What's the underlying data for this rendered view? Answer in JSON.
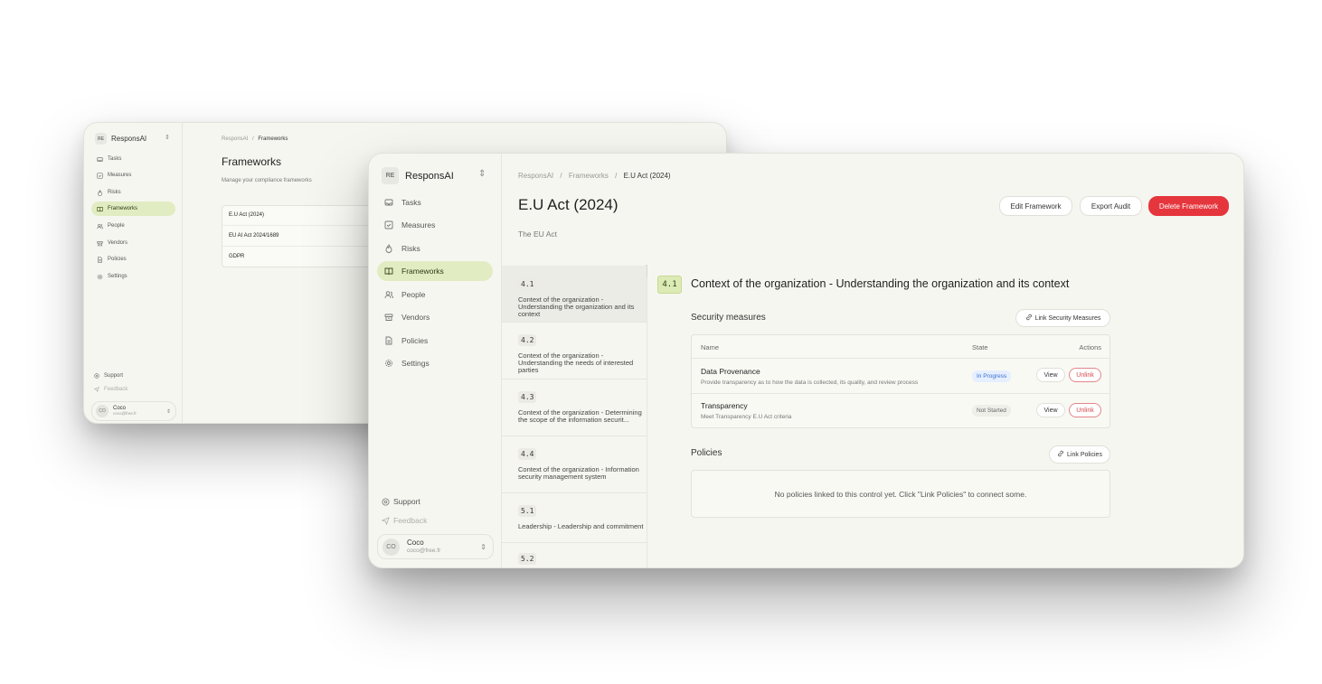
{
  "back_window": {
    "brand": {
      "logo": "RE",
      "name": "ResponsAI"
    },
    "nav": [
      {
        "label": "Tasks",
        "icon": "inbox-icon"
      },
      {
        "label": "Measures",
        "icon": "checkbox-icon"
      },
      {
        "label": "Risks",
        "icon": "flame-icon"
      },
      {
        "label": "Frameworks",
        "icon": "book-icon"
      },
      {
        "label": "People",
        "icon": "people-icon"
      },
      {
        "label": "Vendors",
        "icon": "box-icon"
      },
      {
        "label": "Policies",
        "icon": "file-icon"
      },
      {
        "label": "Settings",
        "icon": "gear-icon"
      }
    ],
    "footer": {
      "support": "Support",
      "feedback": "Feedback"
    },
    "user": {
      "initials": "CO",
      "name": "Coco",
      "email": "coco@free.fr"
    },
    "breadcrumb": {
      "root": "ResponsAI",
      "sep": "/",
      "current": "Frameworks"
    },
    "title": "Frameworks",
    "subtitle": "Manage your compliance frameworks",
    "frameworks": [
      "E.U Act (2024)",
      "EU AI Act 2024/1689",
      "GDPR"
    ]
  },
  "front_window": {
    "brand": {
      "logo": "RE",
      "name": "ResponsAI"
    },
    "nav": [
      {
        "label": "Tasks",
        "icon": "inbox-icon"
      },
      {
        "label": "Measures",
        "icon": "checkbox-icon"
      },
      {
        "label": "Risks",
        "icon": "flame-icon"
      },
      {
        "label": "Frameworks",
        "icon": "book-icon"
      },
      {
        "label": "People",
        "icon": "people-icon"
      },
      {
        "label": "Vendors",
        "icon": "box-icon"
      },
      {
        "label": "Policies",
        "icon": "file-icon"
      },
      {
        "label": "Settings",
        "icon": "gear-icon"
      }
    ],
    "footer": {
      "support": "Support",
      "feedback": "Feedback"
    },
    "user": {
      "initials": "CO",
      "name": "Coco",
      "email": "coco@free.fr"
    },
    "breadcrumb": {
      "root": "ResponsAI",
      "sep": "/",
      "mid": "Frameworks",
      "current": "E.U Act (2024)"
    },
    "title": "E.U Act (2024)",
    "subtitle": "The EU Act",
    "buttons": {
      "edit": "Edit Framework",
      "export": "Export Audit",
      "delete": "Delete Framework"
    },
    "controls": [
      {
        "code": "4.1",
        "text": "Context of the organization - Understanding the organization and its context"
      },
      {
        "code": "4.2",
        "text": "Context of the organization - Understanding the needs of interested parties"
      },
      {
        "code": "4.3",
        "text": "Context of the organization - Determining the scope of the information securit..."
      },
      {
        "code": "4.4",
        "text": "Context of the organization - Information security management system"
      },
      {
        "code": "5.1",
        "text": "Leadership - Leadership and commitment"
      },
      {
        "code": "5.2",
        "text": ""
      }
    ],
    "detail": {
      "code": "4.1",
      "title": "Context of the organization - Understanding the organization and its context",
      "security_heading": "Security measures",
      "link_measures": "Link Security Measures",
      "columns": {
        "name": "Name",
        "state": "State",
        "actions": "Actions"
      },
      "measures": [
        {
          "name": "Data Provenance",
          "desc": "Provide transparency as to how the data is collected, its quality, and review process",
          "state": "In Progress",
          "view": "View",
          "unlink": "Unlink"
        },
        {
          "name": "Transparency",
          "desc": "Meet Transparency E.U Act criteria",
          "state": "Not Started",
          "view": "View",
          "unlink": "Unlink"
        }
      ],
      "policies_heading": "Policies",
      "link_policies": "Link Policies",
      "empty_policies": "No policies linked to this control yet. Click \"Link Policies\" to connect some."
    }
  }
}
